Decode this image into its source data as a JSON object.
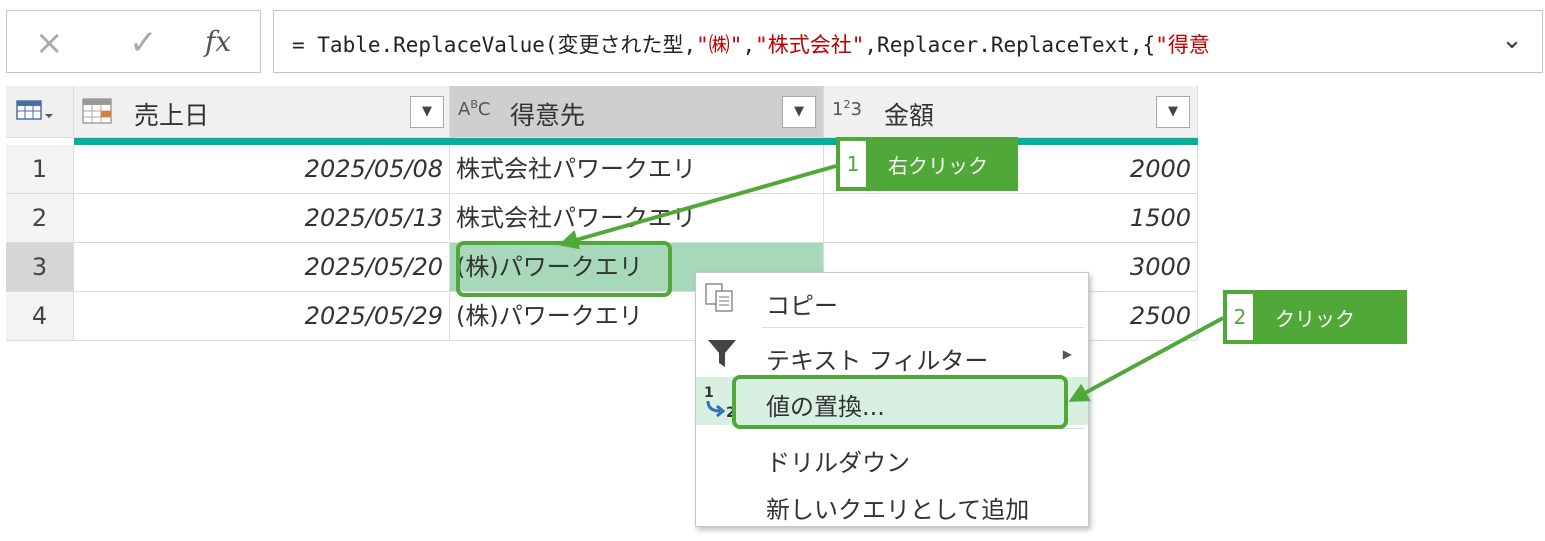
{
  "formula_bar": {
    "cancel_icon": "×",
    "confirm_icon": "✓",
    "fx_label": "fx",
    "formula_prefix": "= Table.ReplaceValue(変更された型,",
    "formula_str1": "\"㈱\"",
    "formula_sep1": ",",
    "formula_str2": "\"株式会社\"",
    "formula_mid": ",Replacer.ReplaceText,{",
    "formula_str3": "\"得意",
    "expand_icon": "⌄"
  },
  "table": {
    "corner_icon": "table-menu-icon",
    "columns": [
      {
        "type_icon": "▦",
        "label": "売上日"
      },
      {
        "type_icon": "ABC",
        "label": "得意先"
      },
      {
        "type_icon": "123",
        "label": "金額"
      }
    ],
    "rows": [
      {
        "index": "1",
        "date": "2025/05/08",
        "customer": "株式会社パワークエリ",
        "amount": "2000"
      },
      {
        "index": "2",
        "date": "2025/05/13",
        "customer": "株式会社パワークエリ",
        "amount": "1500"
      },
      {
        "index": "3",
        "date": "2025/05/20",
        "customer": "(株)パワークエリ",
        "amount": "3000"
      },
      {
        "index": "4",
        "date": "2025/05/29",
        "customer": "(株)パワークエリ",
        "amount": "2500"
      }
    ]
  },
  "context_menu": {
    "items": [
      {
        "label": "コピー",
        "icon": "copy-icon"
      },
      {
        "label": "テキスト フィルター",
        "icon": "filter-icon"
      },
      {
        "label": "値の置換...",
        "icon": "replace-values-icon"
      },
      {
        "label": "ドリルダウン"
      },
      {
        "label": "新しいクエリとして追加"
      }
    ]
  },
  "callouts": [
    {
      "number": "1",
      "text": "右クリック"
    },
    {
      "number": "2",
      "text": "クリック"
    }
  ],
  "colors": {
    "accent_green": "#50a838",
    "teal": "#00b09b",
    "highlight": "#a7d8b9",
    "string_red": "#c00000"
  }
}
